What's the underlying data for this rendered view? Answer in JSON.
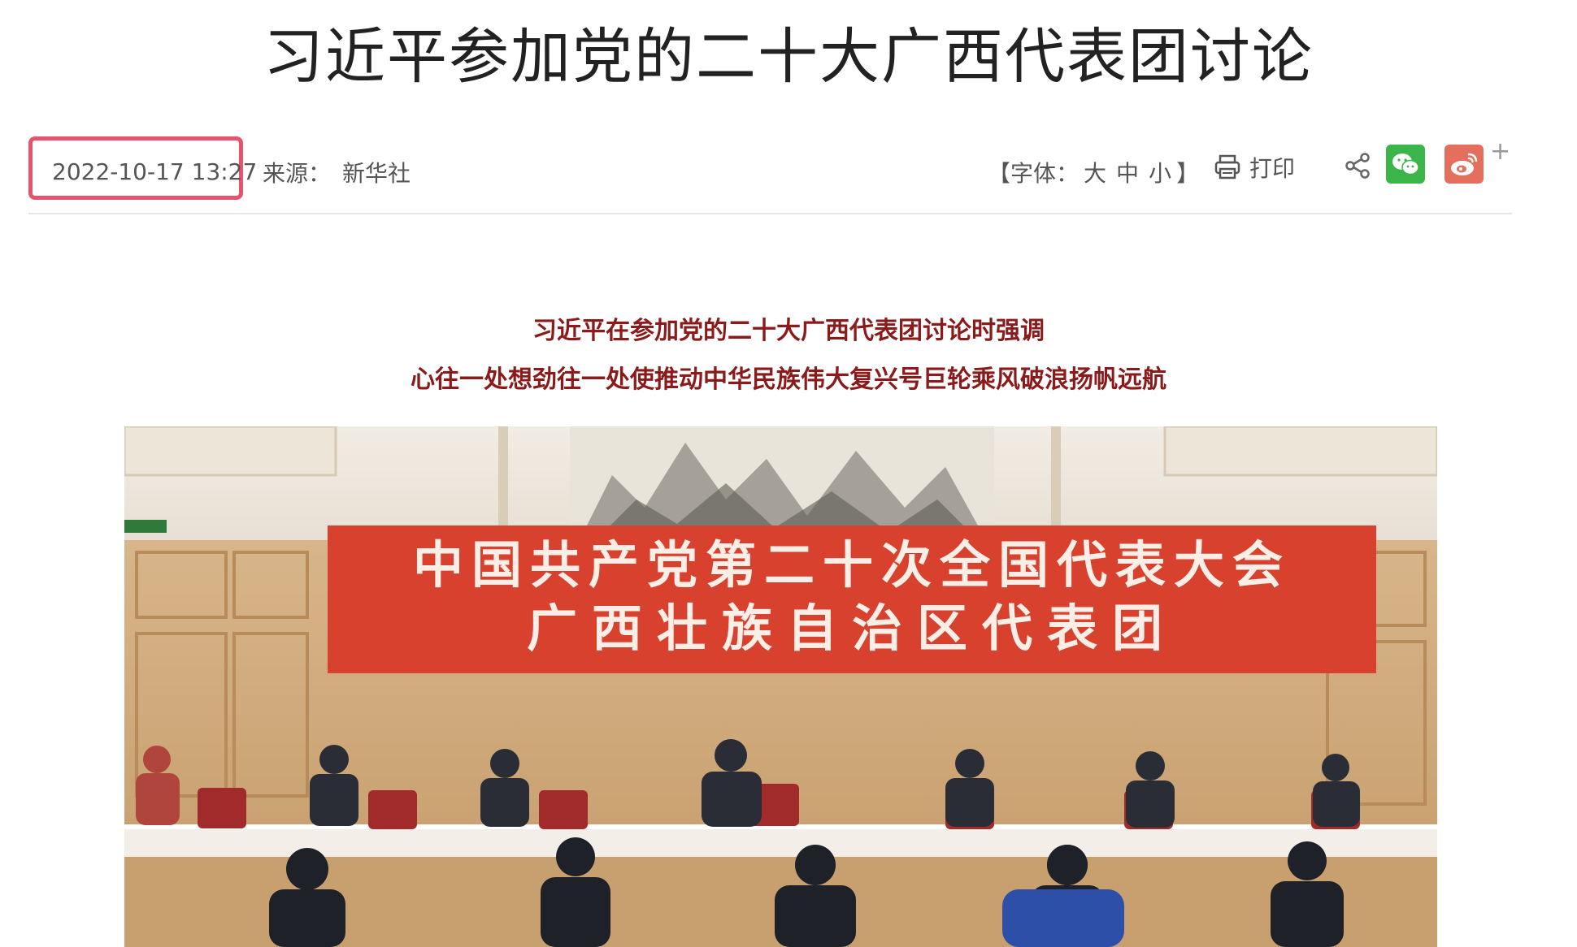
{
  "article": {
    "title": "习近平参加党的二十大广西代表团讨论",
    "subtitle_line1": "习近平在参加党的二十大广西代表团讨论时强调",
    "subtitle_line2": "心往一处想劲往一处使推动中华民族伟大复兴号巨轮乘风破浪扬帆远航"
  },
  "meta": {
    "datetime": "2022-10-17 13:27",
    "source_label": "来源：",
    "source_name": "新华社"
  },
  "toolbar": {
    "fontsize_open": "【字体：",
    "fontsize_large": "大",
    "fontsize_medium": "中",
    "fontsize_small": "小",
    "fontsize_close": "】",
    "print_label": "打印",
    "plus": "+"
  },
  "photo": {
    "banner_line1": "中国共产党第二十次全国代表大会",
    "banner_line2": "广西壮族自治区代表团"
  },
  "colors": {
    "highlight_border": "#e8536c",
    "subtitle": "#8b1a1a",
    "wechat": "#3bb54a",
    "weibo": "#e36f5c",
    "banner": "#d9412f"
  },
  "icons": {
    "print": "printer-icon",
    "share": "share-icon",
    "wechat": "wechat-icon",
    "weibo": "weibo-icon"
  }
}
